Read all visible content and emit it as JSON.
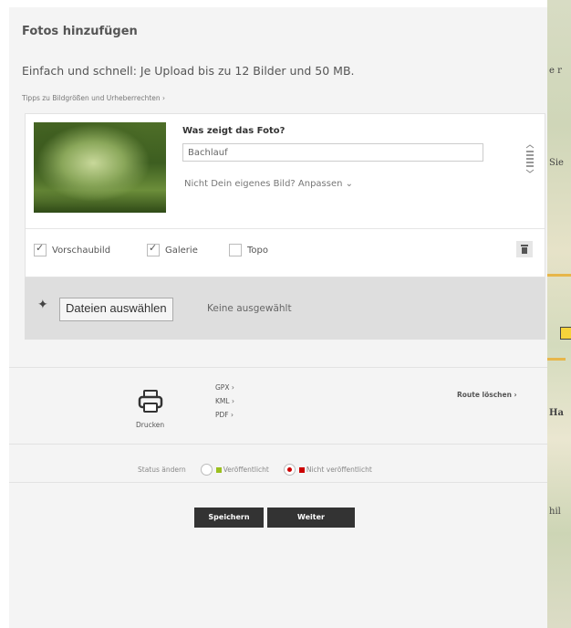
{
  "header": {
    "title": "Fotos hinzufügen",
    "subtitle": "Einfach und schnell: Je Upload bis zu 12 Bilder und 50 MB.",
    "tips_link": "Tipps zu Bildgrößen und Urheberrechten ›"
  },
  "photo_card": {
    "question": "Was zeigt das Foto?",
    "caption_value": "Bachlauf",
    "adjust_link": "Nicht Dein eigenes Bild? Anpassen",
    "options": [
      {
        "label": "Vorschaubild",
        "checked": true
      },
      {
        "label": "Galerie",
        "checked": true
      },
      {
        "label": "Topo",
        "checked": false
      }
    ]
  },
  "upload": {
    "button": "Dateien auswählen",
    "status": "Keine ausgewählt"
  },
  "export": {
    "print_label": "Drucken",
    "gpx": "GPX ›",
    "kml": "KML ›",
    "pdf": "PDF ›",
    "delete_route": "Route löschen ›"
  },
  "status": {
    "label": "Status ändern",
    "published": "Veröffentlicht",
    "unpublished": "Nicht veröffentlicht",
    "selected": "unpublished",
    "published_color": "#9bbf1f",
    "unpublished_color": "#cc0000"
  },
  "actions": {
    "save": "Speichern",
    "next": "Weiter"
  },
  "map": {
    "labels": [
      "e r",
      "Sie",
      "Ha",
      "hil"
    ]
  }
}
